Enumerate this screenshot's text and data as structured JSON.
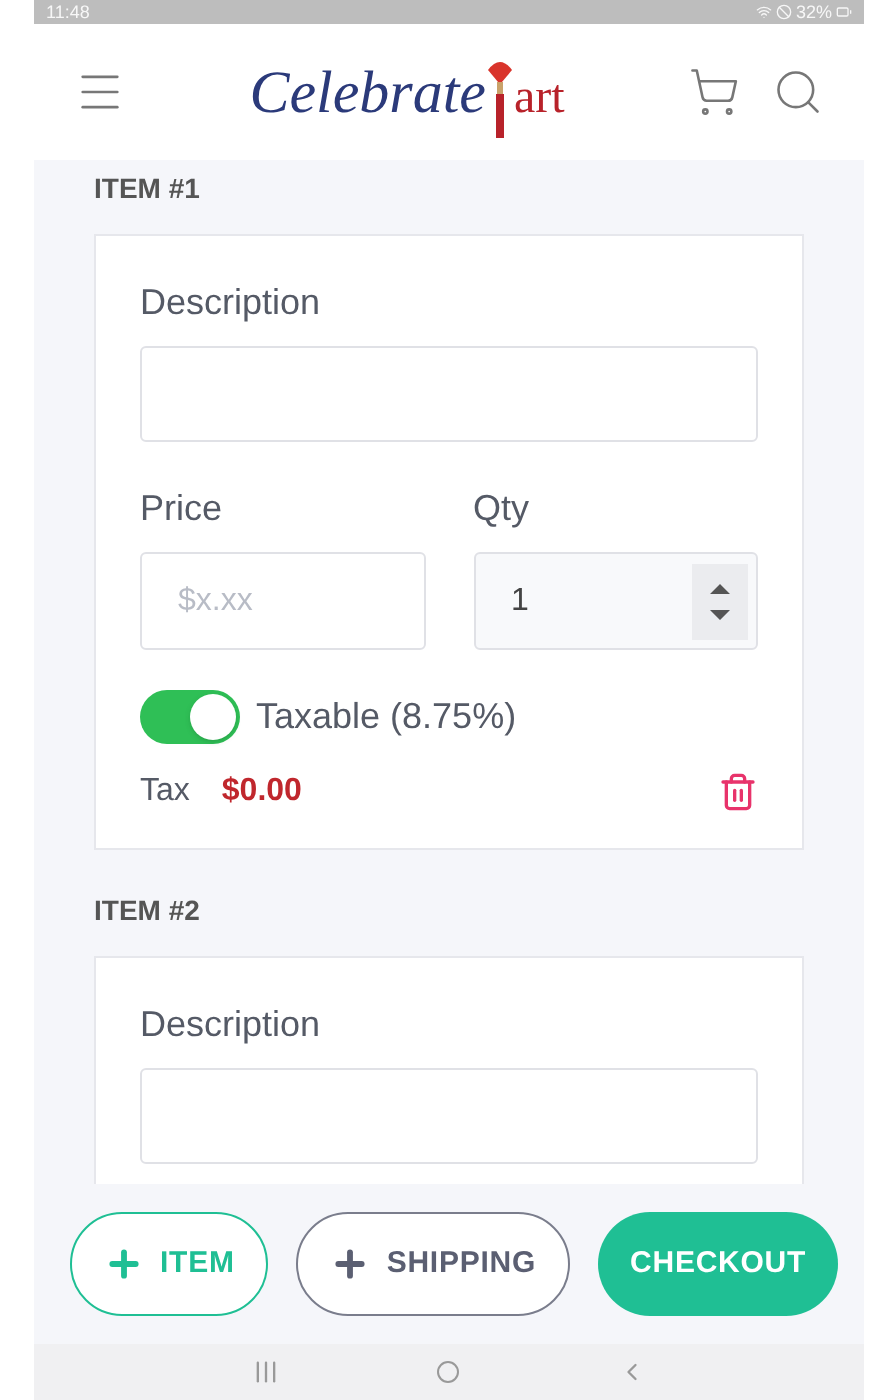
{
  "status_bar": {
    "time": "11:48",
    "battery": "32%"
  },
  "header": {
    "logo_text": "Celebrate",
    "logo_accent": "art"
  },
  "items": [
    {
      "heading": "ITEM #1",
      "description_label": "Description",
      "price_label": "Price",
      "price_placeholder": "$x.xx",
      "qty_label": "Qty",
      "qty_value": "1",
      "taxable_label": "Taxable (8.75%)",
      "taxable": true,
      "tax_label": "Tax",
      "tax_value": "$0.00"
    },
    {
      "heading": "ITEM #2",
      "description_label": "Description"
    }
  ],
  "buttons": [
    {
      "kind": "outline-green",
      "label": "ITEM"
    },
    {
      "kind": "outline-gray",
      "label": "SHIPPING"
    },
    {
      "kind": "solid",
      "label": "CHECKOUT"
    }
  ]
}
